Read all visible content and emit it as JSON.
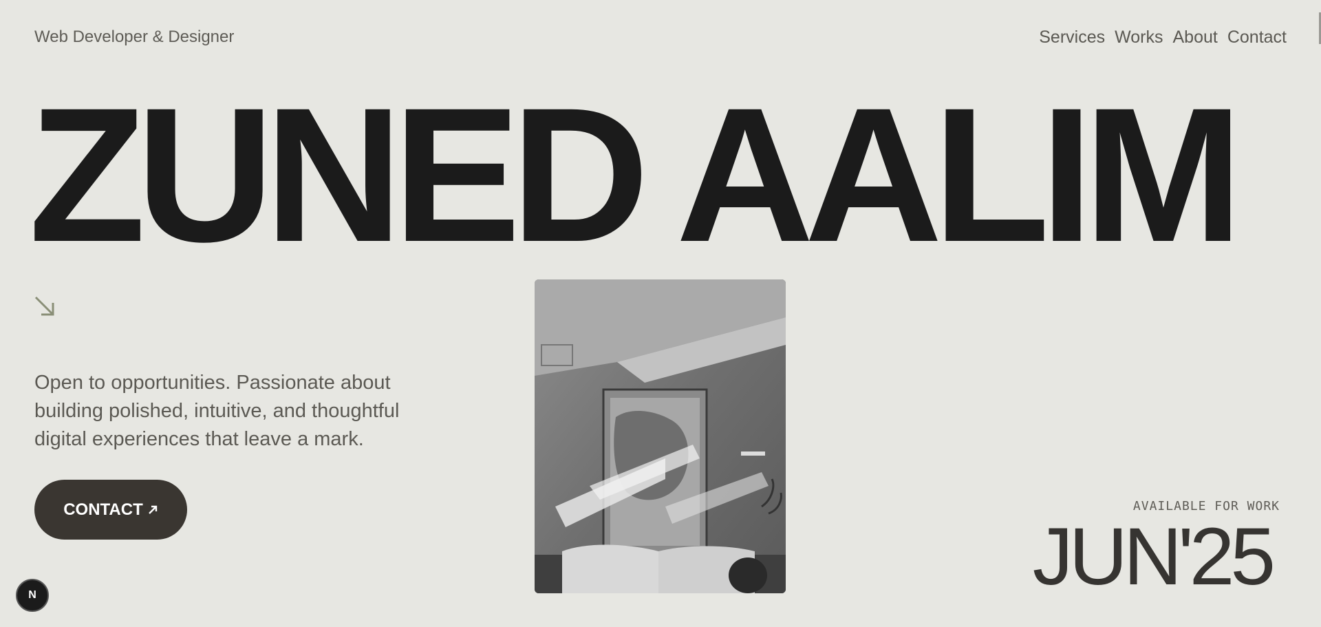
{
  "header": {
    "role": "Web Developer & Designer",
    "nav": [
      "Services",
      "Works",
      "About",
      "Contact"
    ]
  },
  "hero": {
    "name": "ZUNED AALIM",
    "tagline": "Open to opportunities. Passionate about building polished, intuitive, and thoughtful digital experiences that leave a mark.",
    "contact_label": "CONTACT",
    "arrow_icon": "arrow-down-right-icon"
  },
  "availability": {
    "label": "AVAILABLE FOR WORK",
    "date": "JUN'25"
  },
  "badge": {
    "letter": "N"
  },
  "colors": {
    "background": "#e7e7e2",
    "text": "#1b1b1b",
    "muted": "#5e5c56",
    "button": "#3a3631",
    "accent": "#8a8f77"
  }
}
